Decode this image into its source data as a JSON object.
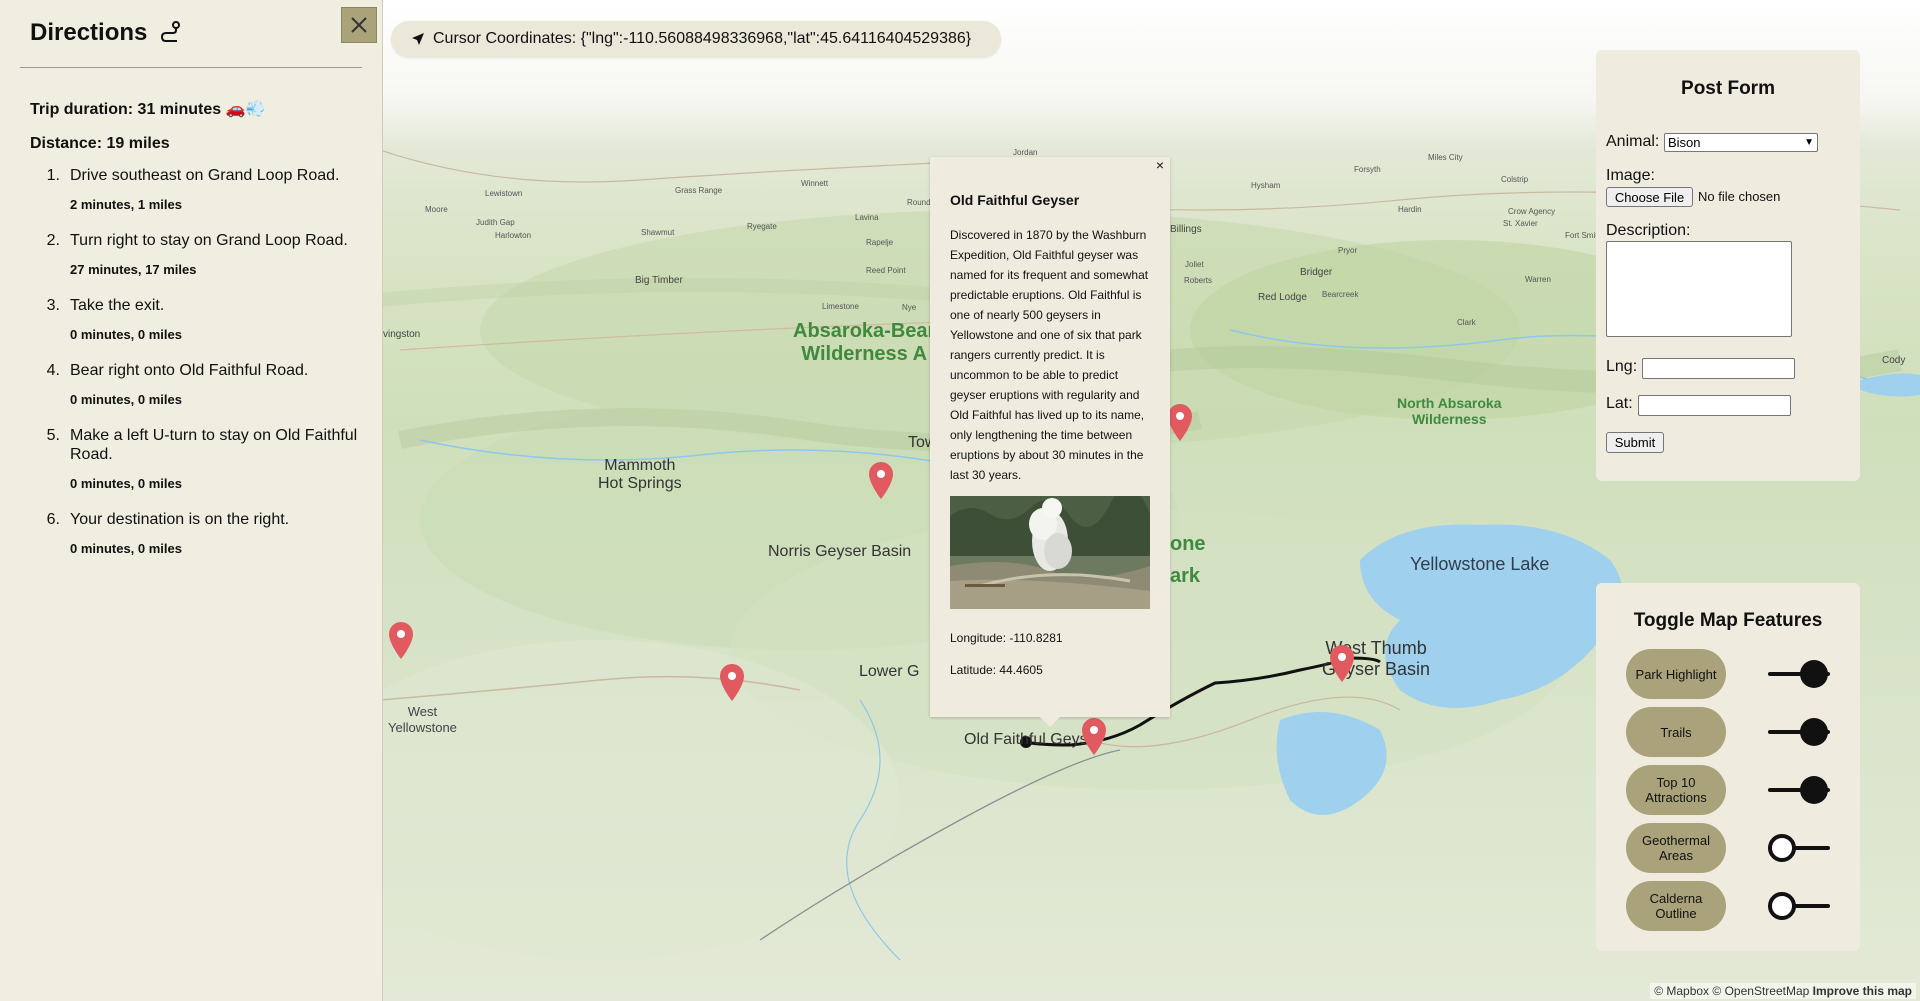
{
  "directions": {
    "title": "Directions",
    "close_label": "×",
    "trip_duration": "Trip duration: 31 minutes 🚗💨",
    "distance": "Distance: 19 miles",
    "steps": [
      {
        "num": "1.",
        "text": "Drive southeast on Grand Loop Road.",
        "meta": "2 minutes, 1 miles"
      },
      {
        "num": "2.",
        "text": "Turn right to stay on Grand Loop Road.",
        "meta": "27 minutes, 17 miles"
      },
      {
        "num": "3.",
        "text": "Take the exit.",
        "meta": "0 minutes, 0 miles"
      },
      {
        "num": "4.",
        "text": "Bear right onto Old Faithful Road.",
        "meta": "0 minutes, 0 miles"
      },
      {
        "num": "5.",
        "text": "Make a left U-turn to stay on Old Faithful Road.",
        "meta": "0 minutes, 0 miles"
      },
      {
        "num": "6.",
        "text": "Your destination is on the right.",
        "meta": "0 minutes, 0 miles"
      }
    ]
  },
  "coord_bar": {
    "text": "Cursor Coordinates: {\"lng\":-110.56088498336968,\"lat\":45.64116404529386}",
    "icon": "navigation-arrow-icon"
  },
  "popup": {
    "close_label": "×",
    "title": "Old Faithful Geyser",
    "description": "Discovered in 1870 by the Washburn Expedition, Old Faithful geyser was named for its frequent and somewhat predictable eruptions. Old Faithful is one of nearly 500 geysers in Yellowstone and one of six that park rangers currently predict. It is uncommon to be able to predict geyser eruptions with regularity and Old Faithful has lived up to its name, only lengthening the time between eruptions by about 30 minutes in the last 30 years.",
    "longitude": "Longitude: -110.8281",
    "latitude": "Latitude: 44.4605"
  },
  "post_form": {
    "title": "Post Form",
    "animal_label": "Animal:",
    "animal_selected": "Bison",
    "image_label": "Image:",
    "file_button": "Choose File",
    "file_status": "No file chosen",
    "description_label": "Description:",
    "lng_label": "Lng:",
    "lat_label": "Lat:",
    "submit_label": "Submit"
  },
  "toggle_panel": {
    "title": "Toggle Map Features",
    "features": [
      {
        "label": "Park Highlight",
        "on": true
      },
      {
        "label": "Trails",
        "on": true
      },
      {
        "label": "Top 10 Attractions",
        "on": true
      },
      {
        "label": "Geothermal Areas",
        "on": false
      },
      {
        "label": "Calderna Outline",
        "on": false
      }
    ]
  },
  "map": {
    "labels": {
      "absaroka": "Absaroka-Bear",
      "absaroka2": "Wilderness A",
      "mammoth": "Mammoth",
      "mammoth2": "Hot Springs",
      "norris": "Norris Geyser Basin",
      "lower": "Lower G",
      "old_faithful": "Old Faithful Geyser",
      "west_thumb": "West Thumb",
      "west_thumb2": "Geyser Basin",
      "yellowstone_lake": "Yellowstone Lake",
      "north_absaroka": "North Absaroka",
      "north_absaroka2": "Wilderness",
      "west_yellowstone": "West",
      "west_yellowstone2": "Yellowstone",
      "park_one": "one",
      "park_ark": "ark",
      "tow": "Tow",
      "billings": "Billings",
      "bridger": "Bridger",
      "red_lodge": "Red Lodge",
      "bearcreek": "Bearcreek",
      "big_timber": "Big Timber",
      "livingston": "vingston",
      "lewistown": "Lewistown",
      "harlowton": "Harlowton",
      "judith_gap": "Judith Gap",
      "moore": "Moore",
      "grass_range": "Grass Range",
      "winnett": "Winnett",
      "roundup": "Round",
      "lavina": "Lavina",
      "ryegate": "Ryegate",
      "shawmut": "Shawmut",
      "rapelje": "Rapelje",
      "reed_point": "Reed Point",
      "limestone": "Limestone",
      "nye": "Nye",
      "jordan": "Jordan",
      "hysham": "Hysham",
      "forsyth": "Forsyth",
      "miles_city": "Miles City",
      "colstrip": "Colstrip",
      "hardin": "Hardin",
      "crow_agency": "Crow Agency",
      "st_xavier": "St. Xavier",
      "fort_smith": "Fort Smith",
      "pryor": "Pryor",
      "warren": "Warren",
      "clark": "Clark",
      "cody": "Cody",
      "roberts": "Roberts",
      "joliet": "Joliet"
    }
  },
  "attribution": {
    "mapbox": "© Mapbox",
    "osm": "© OpenStreetMap",
    "improve": "Improve this map"
  },
  "colors": {
    "panel_bg": "#efeee0",
    "button_tan": "#aaa27a",
    "marker_red": "#e05a5f",
    "water": "#9fd0ee",
    "park_green": "#3f8a3c"
  }
}
